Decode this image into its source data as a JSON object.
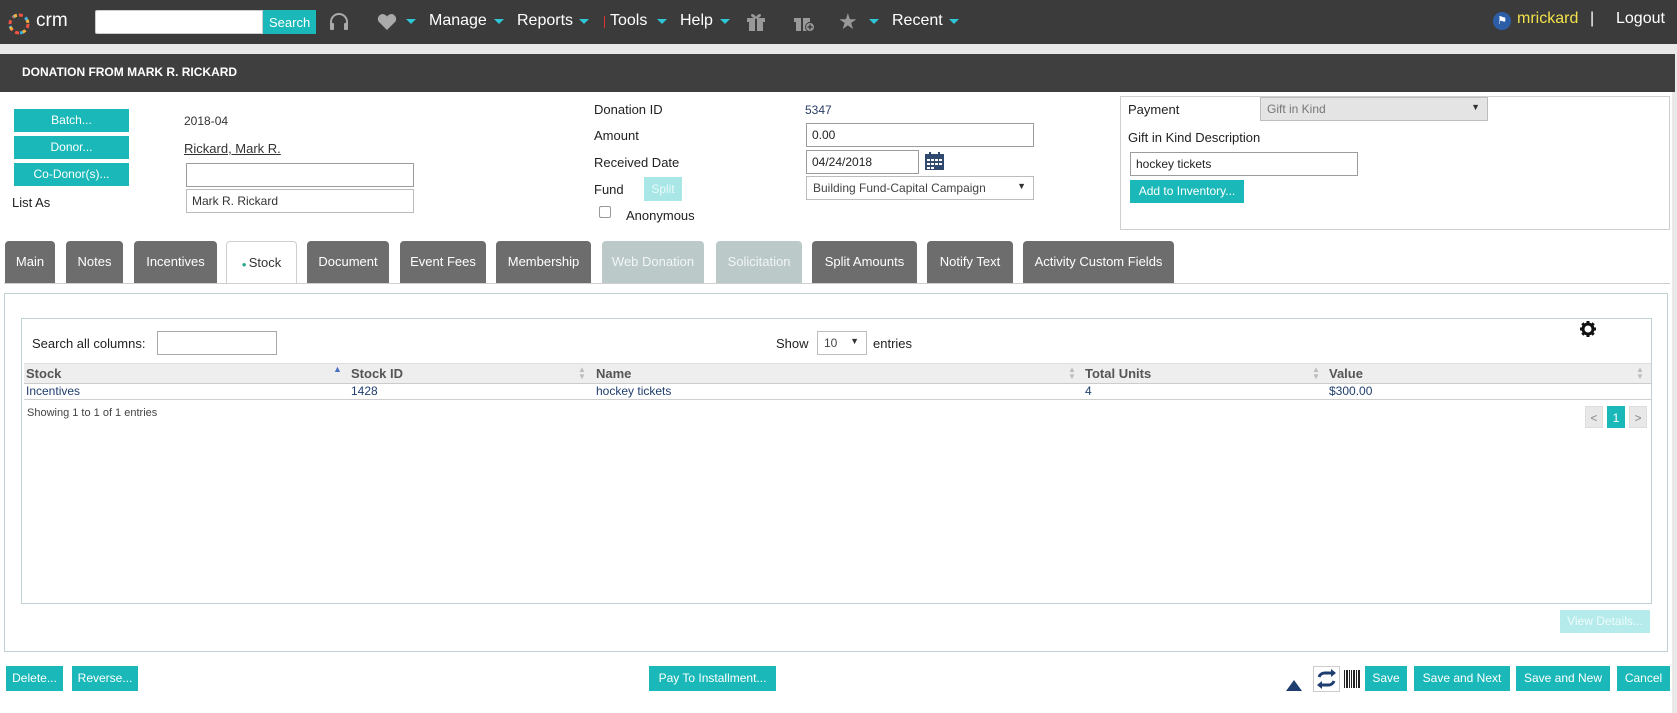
{
  "nav": {
    "logo_text": "crm",
    "search_placeholder": "",
    "search_label": "Search",
    "menu": [
      "Manage",
      "Reports",
      "Tools",
      "Help",
      "Recent"
    ],
    "user": "mrickard",
    "separator": "|",
    "logout": "Logout"
  },
  "page": {
    "title": "DONATION FROM MARK R. RICKARD"
  },
  "left": {
    "batch_btn": "Batch...",
    "donor_btn": "Donor...",
    "codonor_btn": "Co-Donor(s)...",
    "list_as_label": "List As",
    "batch_value": "2018-04",
    "donor_value": "Rickard, Mark R.",
    "codonor_value": "",
    "list_as_value": "Mark R. Rickard"
  },
  "middle": {
    "donation_id_label": "Donation ID",
    "donation_id_value": "5347",
    "amount_label": "Amount",
    "amount_value": "0.00",
    "received_label": "Received Date",
    "received_value": "04/24/2018",
    "fund_label": "Fund",
    "split_btn": "Split",
    "fund_value": "Building Fund-Capital Campaign",
    "anonymous_label": "Anonymous"
  },
  "payment": {
    "label": "Payment",
    "value": "Gift in Kind",
    "gik_label": "Gift in Kind Description",
    "gik_value": "hockey tickets",
    "add_inventory_btn": "Add to Inventory..."
  },
  "tabs": [
    {
      "label": "Main"
    },
    {
      "label": "Notes"
    },
    {
      "label": "Incentives"
    },
    {
      "label": "Stock"
    },
    {
      "label": "Document"
    },
    {
      "label": "Event Fees"
    },
    {
      "label": "Membership"
    },
    {
      "label": "Web Donation"
    },
    {
      "label": "Solicitation"
    },
    {
      "label": "Split Amounts"
    },
    {
      "label": "Notify Text"
    },
    {
      "label": "Activity Custom Fields"
    }
  ],
  "table": {
    "search_label": "Search all columns:",
    "search_value": "",
    "show_label": "Show",
    "show_value": "10",
    "entries_label": "entries",
    "columns": [
      "Stock",
      "Stock ID",
      "Name",
      "Total Units",
      "Value"
    ],
    "rows": [
      [
        "Incentives",
        "1428",
        "hockey tickets",
        "4",
        "$300.00"
      ]
    ],
    "info": "Showing 1 to 1 of 1 entries",
    "page_prev": "<",
    "page_current": "1",
    "page_next": ">",
    "view_details_btn": "View Details..."
  },
  "footer": {
    "delete_btn": "Delete...",
    "reverse_btn": "Reverse...",
    "pay_installment_btn": "Pay To Installment...",
    "save_btn": "Save",
    "save_next_btn": "Save and Next",
    "save_new_btn": "Save and New",
    "cancel_btn": "Cancel"
  },
  "colors": {
    "accent": "#1ab8b8",
    "nav_bg": "#3b3b3b",
    "user": "#f2e24a",
    "disabled_tab": "#bcc9c9"
  }
}
